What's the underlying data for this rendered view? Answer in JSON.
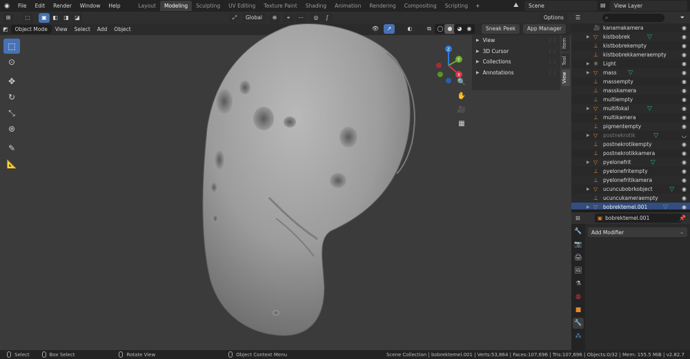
{
  "menubar": {
    "items": [
      "File",
      "Edit",
      "Render",
      "Window",
      "Help"
    ],
    "workspaces": [
      "Layout",
      "Modeling",
      "Sculpting",
      "UV Editing",
      "Texture Paint",
      "Shading",
      "Animation",
      "Rendering",
      "Compositing",
      "Scripting"
    ],
    "active_workspace": "Modeling",
    "add_workspace": "+",
    "scene": "Scene",
    "view_layer": "View Layer"
  },
  "viewport": {
    "mode": "Object Mode",
    "menus": [
      "View",
      "Select",
      "Add",
      "Object"
    ],
    "orientation": "Global",
    "options_label": "Options",
    "sneak_peek": "Sneak Peek",
    "app_manager": "App Manager",
    "gizmo": {
      "z": "Z",
      "y": "Y",
      "x": "X"
    },
    "npanel": {
      "sections": [
        "View",
        "3D Cursor",
        "Collections",
        "Annotations"
      ],
      "tabs": [
        "Item",
        "Tool",
        "View"
      ],
      "active_tab": "View"
    }
  },
  "outliner": {
    "rows": [
      {
        "name": "kanamakamera",
        "type": "camera",
        "expand": false,
        "dim": false,
        "modifier": false
      },
      {
        "name": "kistbobrek",
        "type": "mesh",
        "expand": true,
        "dim": false,
        "modifier": true
      },
      {
        "name": "kistbobrekempty",
        "type": "empty",
        "expand": false,
        "dim": false,
        "modifier": false
      },
      {
        "name": "kistbobrekkameraempty",
        "type": "empty",
        "expand": false,
        "dim": false,
        "modifier": false
      },
      {
        "name": "Light",
        "type": "light",
        "expand": true,
        "dim": false,
        "modifier": false
      },
      {
        "name": "mass",
        "type": "mesh",
        "expand": true,
        "dim": false,
        "modifier": true
      },
      {
        "name": "massempty",
        "type": "empty",
        "expand": false,
        "dim": false,
        "modifier": false
      },
      {
        "name": "masskamera",
        "type": "empty",
        "expand": false,
        "dim": false,
        "modifier": false
      },
      {
        "name": "multiempty",
        "type": "empty",
        "expand": false,
        "dim": false,
        "modifier": false
      },
      {
        "name": "multifokal",
        "type": "mesh",
        "expand": true,
        "dim": false,
        "modifier": true
      },
      {
        "name": "multikamera",
        "type": "empty",
        "expand": false,
        "dim": false,
        "modifier": false
      },
      {
        "name": "pigmentempty",
        "type": "empty",
        "expand": false,
        "dim": false,
        "modifier": false
      },
      {
        "name": "postnekrotik",
        "type": "mesh",
        "expand": true,
        "dim": true,
        "modifier": true
      },
      {
        "name": "postnekrotikempty",
        "type": "empty",
        "expand": false,
        "dim": false,
        "modifier": false
      },
      {
        "name": "postnekrotikkamera",
        "type": "empty",
        "expand": false,
        "dim": false,
        "modifier": false
      },
      {
        "name": "pyelonefrit",
        "type": "mesh",
        "expand": true,
        "dim": false,
        "modifier": true
      },
      {
        "name": "pyelonefritempty",
        "type": "empty",
        "expand": false,
        "dim": false,
        "modifier": false
      },
      {
        "name": "pyelonefritikamera",
        "type": "empty",
        "expand": false,
        "dim": false,
        "modifier": false
      },
      {
        "name": "ucuncubobrkobject",
        "type": "mesh",
        "expand": true,
        "dim": false,
        "modifier": true
      },
      {
        "name": "ucuncukameraempty",
        "type": "empty",
        "expand": false,
        "dim": false,
        "modifier": false
      },
      {
        "name": "bobrektemel.001",
        "type": "mesh",
        "expand": true,
        "dim": false,
        "modifier": true,
        "selected": true
      }
    ]
  },
  "properties": {
    "object_name": "bobrektemel.001",
    "add_modifier": "Add Modifier"
  },
  "statusbar": {
    "select": "Select",
    "box_select": "Box Select",
    "rotate_view": "Rotate View",
    "context_menu": "Object Context Menu",
    "stats": "Scene Collection | bobrektemel.001 | Verts:53,864 | Faces:107,696 | Tris:107,696 | Objects:0/32 | Mem: 155.5 MiB | v2.82.7"
  },
  "colors": {
    "accent": "#4772b3",
    "selection": "#334d80",
    "mesh_icon": "#e8892b",
    "modifier_icon": "#2fb38a"
  }
}
